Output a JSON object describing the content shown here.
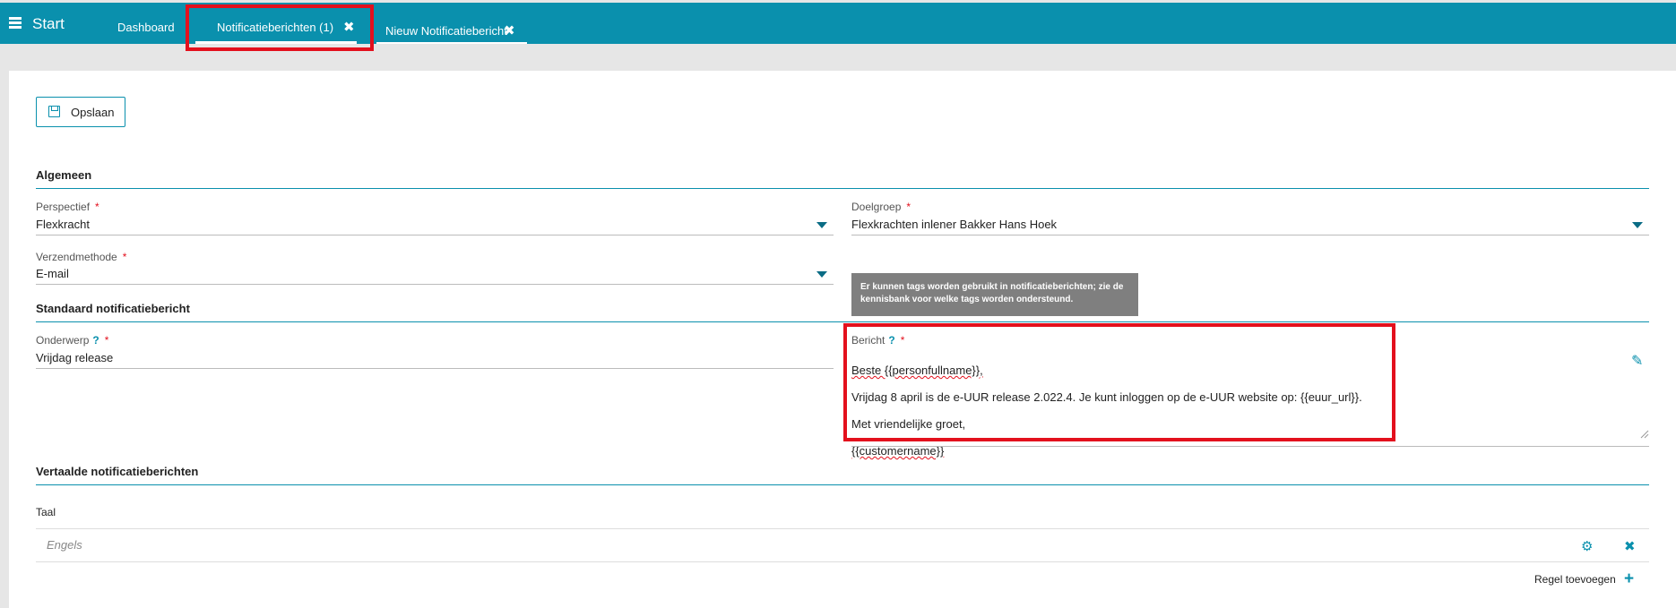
{
  "topbar": {
    "start_label": "Start",
    "tabs": [
      {
        "label": "Dashboard"
      },
      {
        "label": "Notificatieberichten (1)"
      },
      {
        "label": "Nieuw Notificatiebericht"
      }
    ],
    "close_glyph": "✖"
  },
  "toolbar": {
    "save_label": "Opslaan"
  },
  "sections": {
    "general": "Algemeen",
    "standard": "Standaard notificatiebericht",
    "translated": "Vertaalde notificatieberichten"
  },
  "fields": {
    "perspective": {
      "label": "Perspectief",
      "value": "Flexkracht"
    },
    "target_group": {
      "label": "Doelgroep",
      "value": "Flexkrachten inlener Bakker Hans Hoek"
    },
    "send_method": {
      "label": "Verzendmethode",
      "value": "E-mail"
    },
    "subject": {
      "label": "Onderwerp",
      "value": "Vrijdag release"
    },
    "message": {
      "label": "Bericht",
      "lines": [
        "Beste {{personfullname}},",
        "Vrijdag 8 april is de e-UUR release 2.022.4. Je kunt inloggen op de e-UUR website op: {{euur_url}}.",
        "Met vriendelijke groet,",
        "{{customername}}"
      ]
    }
  },
  "required_mark": "*",
  "help_mark": "?",
  "tooltip": "Er kunnen tags worden gebruikt in notificatieberichten; zie de kennisbank voor welke tags worden ondersteund.",
  "translations": {
    "column_header": "Taal",
    "rows": [
      {
        "language": "Engels"
      }
    ],
    "add_rule_label": "Regel toevoegen"
  },
  "colors": {
    "accent": "#0a90ad",
    "highlight": "#e3101d",
    "tooltip_bg": "#7f7f7f"
  },
  "icons": [
    "menu-icon",
    "floppy-disk-icon",
    "pencil-icon",
    "cogs-icon",
    "close-icon",
    "plus-icon",
    "resize-handle-icon"
  ]
}
